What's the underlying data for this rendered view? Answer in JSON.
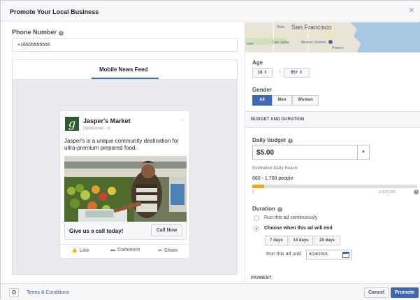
{
  "dialog": {
    "title": "Promote Your Local Business",
    "close_icon": "close-icon"
  },
  "phone": {
    "label": "Phone Number",
    "info_icon": "info-icon",
    "value": "+16505555555"
  },
  "preview": {
    "tab_label": "Mobile News Feed",
    "card": {
      "page_name": "Jasper's Market",
      "sponsored": "Sponsored · ",
      "logo_letter": "g",
      "text": "Jasper's is a unique community destination for ultra-premium prepared food.",
      "cta_text": "Give us a call today!",
      "cta_button": "Call Now",
      "actions": {
        "like": "Like",
        "comment": "Comment",
        "share": "Share"
      }
    }
  },
  "targeting": {
    "map_labels": {
      "city": "San Francisco",
      "vista": "Vista",
      "cole_valley": "Cole Valley",
      "mission_dolores": "Mission Dolores",
      "potrero": "Potrero",
      "inner": "nner"
    },
    "age_label": "Age",
    "age_min": "18",
    "age_max": "65+",
    "age_dash": "-",
    "gender_label": "Gender",
    "gender_options": [
      "All",
      "Men",
      "Women"
    ],
    "gender_selected": "All"
  },
  "budget_section": {
    "header": "BUDGET AND DURATION",
    "daily_budget_label": "Daily budget",
    "daily_budget_value": "$5.00",
    "est_reach_label": "Estimated Daily Reach",
    "est_reach_value": "660 - 1,700 people",
    "reach_min": "0",
    "reach_max": "of 370,000",
    "reach_fill_fraction": 0.07,
    "duration_label": "Duration",
    "duration_options": [
      "Run this ad continuously",
      "Choose when this ad will end"
    ],
    "duration_selected": "Choose when this ad will end",
    "day_options": [
      "7 days",
      "14 days",
      "28 days"
    ],
    "run_until_label": "Run this ad until",
    "run_until_value": "4/24/2015"
  },
  "payment_header": "PAYMENT",
  "footer": {
    "terms": "Terms & Conditions",
    "cancel": "Cancel",
    "promote": "Promote"
  },
  "colors": {
    "accent": "#4267b2",
    "reach_bar": "#f7a513",
    "logo_bg": "#2e5d34",
    "link": "#365899"
  }
}
